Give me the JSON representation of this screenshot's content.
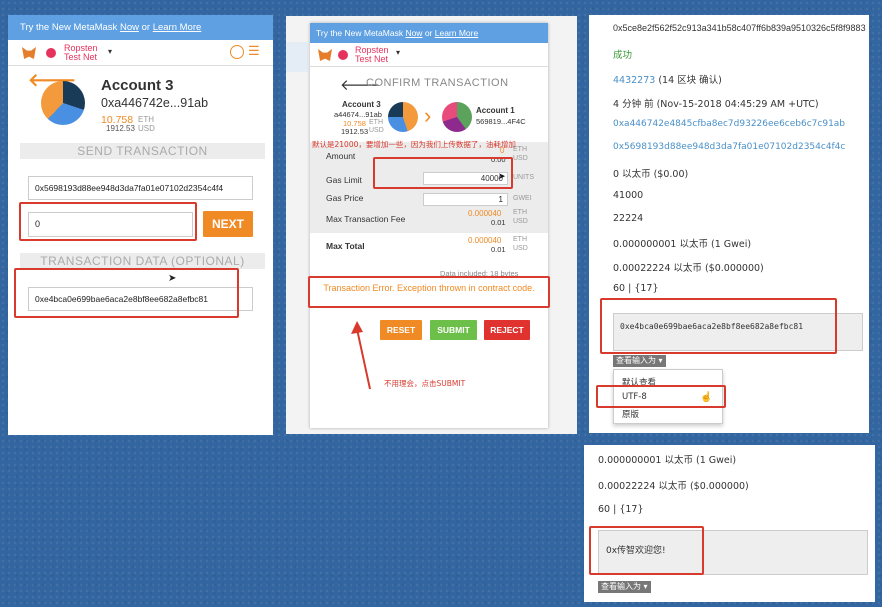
{
  "p1": {
    "banner": {
      "pre": "Try the New MetaMask ",
      "now": "Now",
      "or": " or ",
      "learn": "Learn More"
    },
    "network": [
      "Ropsten",
      "Test Net"
    ],
    "account_name": "Account 3",
    "address": "0xa446742e...91ab",
    "eth_amount": "10.758",
    "eth_unit": "ETH",
    "usd_amount": "1912.53",
    "usd_unit": "USD",
    "send_header": "SEND TRANSACTION",
    "to_address": "0x5698193d88ee948d3da7fa01e07102d2354c4f4",
    "amount_value": "0",
    "next_label": "NEXT",
    "data_header": "TRANSACTION DATA (OPTIONAL)",
    "data_value": "0xe4bca0e699bae6aca2e8bf8ee682a8efbc81"
  },
  "p2": {
    "banner": {
      "pre": "Try the New MetaMask ",
      "now": "Now",
      "or": " or ",
      "learn": "Learn More"
    },
    "network": [
      "Ropsten",
      "Test Net"
    ],
    "title": "CONFIRM TRANSACTION",
    "from": {
      "name": "Account 3",
      "address": "a44674...91ab",
      "eth": "10.758",
      "eth_unit": "ETH",
      "usd": "1912.53",
      "usd_unit": "USD"
    },
    "to": {
      "name": "Account 1",
      "address": "569819...4F4C"
    },
    "annotation_top": "默认是21000，要增加一些，因为我们上传数据了，油耗增加",
    "rows": [
      {
        "label": "Amount",
        "v1": "0",
        "u1": "ETH",
        "v2": "0.00",
        "u2": "USD"
      },
      {
        "label": "Gas Limit",
        "value": "40000",
        "unit": "UNITS"
      },
      {
        "label": "Gas Price",
        "value": "1",
        "unit": "GWEI"
      },
      {
        "label": "Max Transaction Fee",
        "v1": "0.000040",
        "u1": "ETH",
        "v2": "0.01",
        "u2": "USD"
      },
      {
        "label": "Max Total",
        "v1": "0.000040",
        "u1": "ETH",
        "v2": "0.01",
        "u2": "USD"
      }
    ],
    "data_included": "Data included: 18 bytes",
    "error": "Transaction Error. Exception thrown in contract code.",
    "reset": "RESET",
    "submit": "SUBMIT",
    "reject": "REJECT",
    "annotation_bottom": "不用理会，点击SUBMIT"
  },
  "p3": {
    "hash": "0x5ce8e2f562f52c913a341b58c407ff6b839a9510326c5f8f9883",
    "status": "成功",
    "block": "4432273",
    "block_suffix": " (14 区块 确认)",
    "time": "4 分钟 前 (Nov-15-2018 04:45:29 AM +UTC)",
    "from": "0xa446742e4845cfba8ec7d93226ee6ceb6c7c91ab",
    "to": "0x5698193d88ee948d3da7fa01e07102d2354c4f4c",
    "value": "0 以太币 ($0.00)",
    "gas_limit": "41000",
    "gas_used": "22224",
    "gas_price": "0.000000001 以太币 (1 Gwei)",
    "fee": "0.00022224 以太币 ($0.000000)",
    "nonce": "60 | {17}",
    "input": "0xe4bca0e699bae6aca2e8bf8ee682a8efbc81",
    "view_select": "查看输入为",
    "options": [
      "默认查看",
      "UTF-8",
      "原版"
    ]
  },
  "p4": {
    "gas_price": "0.000000001 以太币 (1 Gwei)",
    "fee": "0.00022224 以太币 ($0.000000)",
    "nonce": "60 | {17}",
    "input": "0x传智欢迎您!",
    "view_select": "查看输入为"
  },
  "colors": {
    "metamask_blue": "#5ea0e2",
    "orange": "#f08a24",
    "red_box": "#d83a2e",
    "green": "#6cc04a",
    "reject": "#e0322f",
    "link": "#4a90c8"
  }
}
